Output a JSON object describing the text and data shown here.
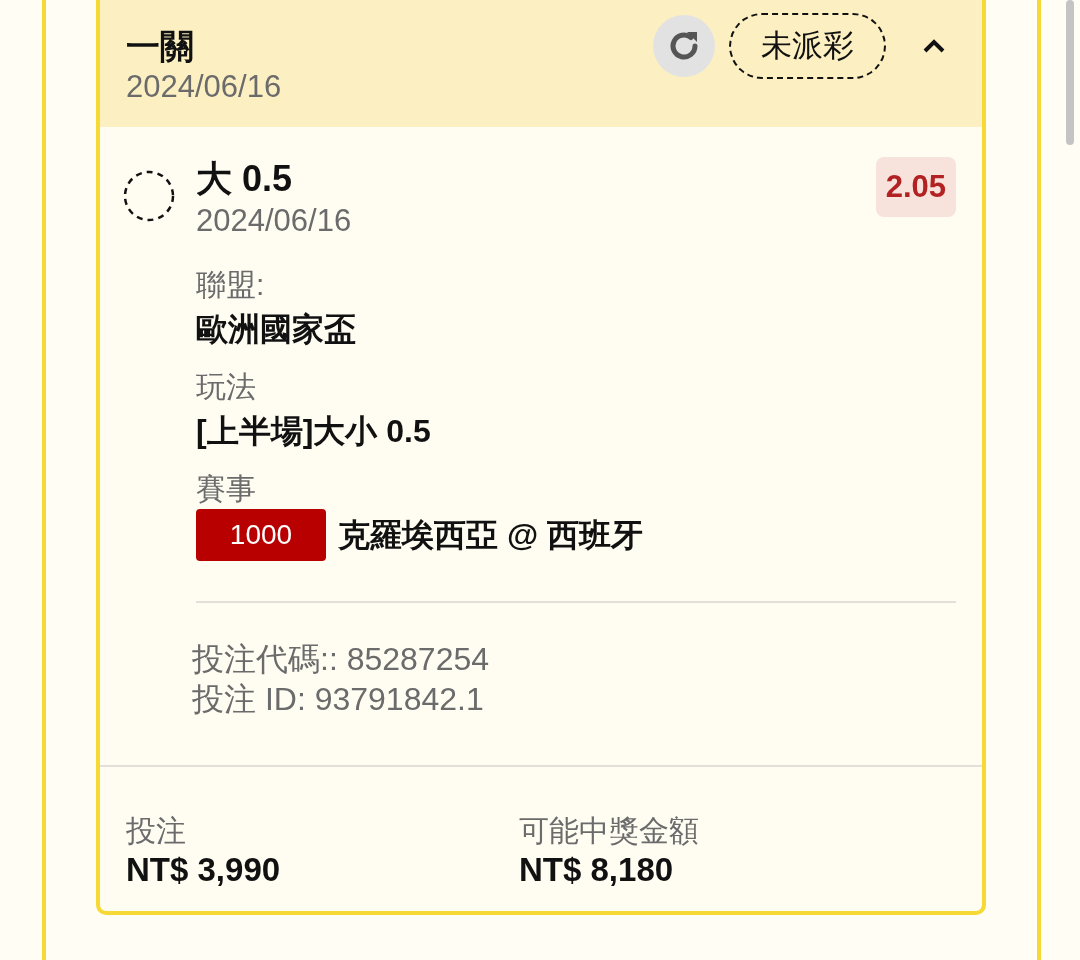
{
  "bet": {
    "title": "一關",
    "date": "2024/06/16",
    "status": "未派彩",
    "expanded": true,
    "selection": {
      "name": "大 0.5",
      "date": "2024/06/16",
      "odds": "2.05"
    },
    "details": [
      {
        "label": "聯盟:",
        "value": "歐洲國家盃"
      },
      {
        "label": "玩法",
        "value": "[上半場]大小 0.5"
      },
      {
        "label": "賽事",
        "value": "克羅埃西亞 @ 西班牙",
        "code": "1000"
      }
    ],
    "references": [
      "投注代碼:: 85287254",
      "投注 ID: 93791842.1"
    ],
    "totals": [
      {
        "label": "投注",
        "value": "NT$ 3,990"
      },
      {
        "label": "可能中獎金額",
        "value": "NT$ 8,180"
      }
    ]
  }
}
